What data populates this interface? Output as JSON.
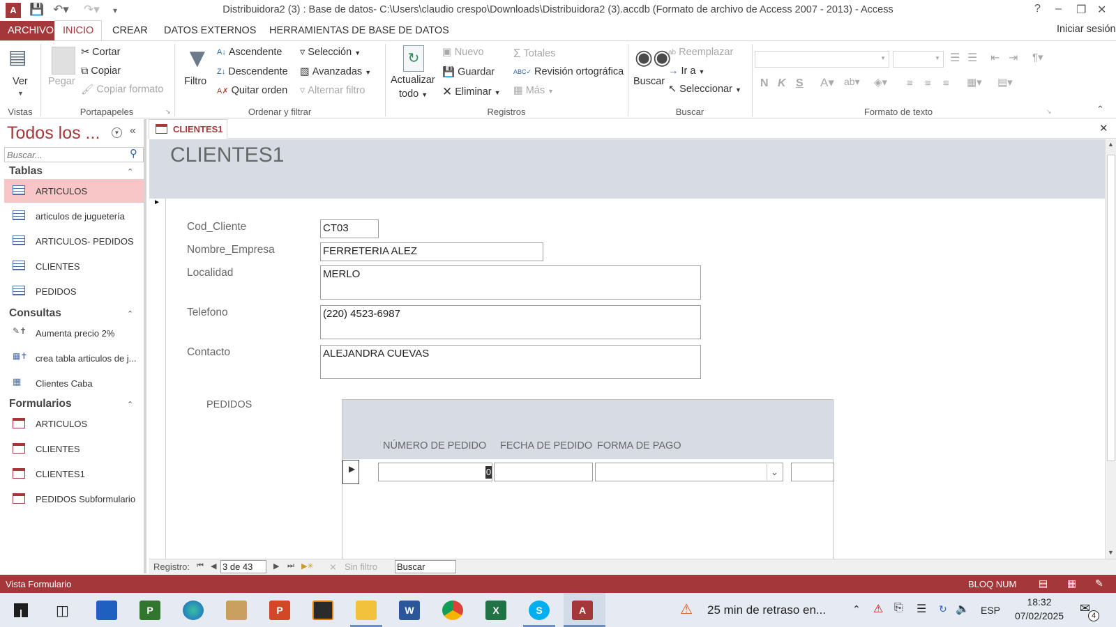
{
  "window": {
    "title": "Distribuidora2 (3) : Base de datos- C:\\Users\\claudio crespo\\Downloads\\Distribuidora2 (3).accdb (Formato de archivo de Access 2007 - 2013) - Access",
    "help": "?",
    "sign_in": "Iniciar sesión"
  },
  "ribbon_tabs": [
    "ARCHIVO",
    "INICIO",
    "CREAR",
    "DATOS EXTERNOS",
    "HERRAMIENTAS DE BASE DE DATOS"
  ],
  "ribbon": {
    "vistas": {
      "label": "Vistas",
      "ver": "Ver"
    },
    "portapapeles": {
      "label": "Portapapeles",
      "pegar": "Pegar",
      "cortar": "Cortar",
      "copiar": "Copiar",
      "copiar_formato": "Copiar formato"
    },
    "ordenar": {
      "label": "Ordenar y filtrar",
      "filtro": "Filtro",
      "ascendente": "Ascendente",
      "descendente": "Descendente",
      "quitar_orden": "Quitar orden",
      "seleccion": "Selección",
      "avanzadas": "Avanzadas",
      "alternar_filtro": "Alternar filtro"
    },
    "registros": {
      "label": "Registros",
      "actualizar": "Actualizar",
      "todo": "todo",
      "nuevo": "Nuevo",
      "guardar": "Guardar",
      "eliminar": "Eliminar",
      "totales": "Totales",
      "revision": "Revisión ortográfica",
      "mas": "Más"
    },
    "buscar": {
      "label": "Buscar",
      "buscar": "Buscar",
      "reemplazar": "Reemplazar",
      "ir_a": "Ir a",
      "seleccionar": "Seleccionar"
    },
    "formato": {
      "label": "Formato de texto",
      "n": "N",
      "k": "K",
      "s": "S"
    }
  },
  "nav": {
    "title": "Todos los ...",
    "search_placeholder": "Buscar...",
    "sections": [
      {
        "label": "Tablas",
        "items": [
          "ARTICULOS",
          "articulos de juguetería",
          "ARTICULOS- PEDIDOS",
          "CLIENTES",
          "PEDIDOS"
        ]
      },
      {
        "label": "Consultas",
        "items": [
          "Aumenta precio 2%",
          "crea tabla articulos de j...",
          "Clientes Caba"
        ]
      },
      {
        "label": "Formularios",
        "items": [
          "ARTICULOS",
          "CLIENTES",
          "CLIENTES1",
          "PEDIDOS Subformulario"
        ]
      }
    ]
  },
  "doc_tab": "CLIENTES1",
  "form": {
    "title": "CLIENTES1",
    "fields": [
      {
        "label": "Cod_Cliente",
        "value": "CT03"
      },
      {
        "label": "Nombre_Empresa",
        "value": "FERRETERIA ALEZ"
      },
      {
        "label": "Localidad",
        "value": "MERLO"
      },
      {
        "label": "Telefono",
        "value": "(220) 4523-6987"
      },
      {
        "label": "Contacto",
        "value": "ALEJANDRA CUEVAS"
      }
    ],
    "subform_label": "PEDIDOS",
    "subform_columns": [
      "NÚMERO DE PEDIDO",
      "FECHA DE PEDIDO",
      "FORMA DE PAGO"
    ],
    "subform_first_value": "0"
  },
  "record_nav": {
    "label": "Registro:",
    "position": "3 de 43",
    "filter": "Sin filtro",
    "search": "Buscar"
  },
  "status": {
    "left": "Vista Formulario",
    "right": "BLOQ NUM"
  },
  "taskbar": {
    "notification": "25 min de retraso en...",
    "lang": "ESP",
    "time": "18:32",
    "date": "07/02/2025",
    "notif_count": "4"
  },
  "colors": {
    "accent": "#a4373a",
    "header_bg": "#d7dbe4"
  }
}
